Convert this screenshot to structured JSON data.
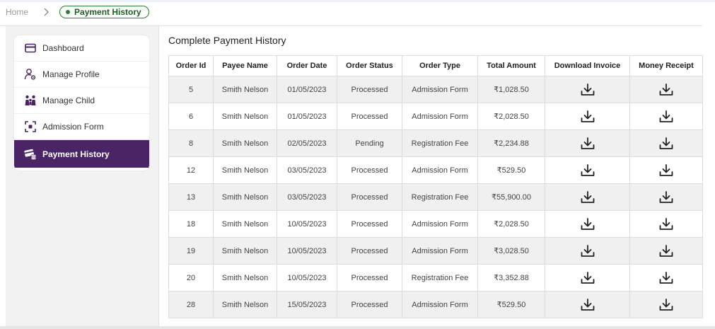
{
  "breadcrumb": {
    "home": "Home",
    "current": "Payment History"
  },
  "sidebar": {
    "items": [
      {
        "label": "Dashboard",
        "icon": "card-icon"
      },
      {
        "label": "Manage Profile",
        "icon": "profile-gear-icon"
      },
      {
        "label": "Manage Child",
        "icon": "family-icon"
      },
      {
        "label": "Admission Form",
        "icon": "scan-icon"
      },
      {
        "label": "Payment History",
        "icon": "payment-icon",
        "active": true
      }
    ]
  },
  "main": {
    "title": "Complete Payment History",
    "columns": [
      "Order Id",
      "Payee Name",
      "Order Date",
      "Order Status",
      "Order Type",
      "Total Amount",
      "Download Invoice",
      "Money Receipt"
    ],
    "rows": [
      {
        "id": "5",
        "payee": "Smith Nelson",
        "date": "01/05/2023",
        "status": "Processed",
        "type": "Admission Form",
        "amount": "₹1,028.50"
      },
      {
        "id": "6",
        "payee": "Smith Nelson",
        "date": "01/05/2023",
        "status": "Processed",
        "type": "Admission Form",
        "amount": "₹2,028.50"
      },
      {
        "id": "8",
        "payee": "Smith Nelson",
        "date": "02/05/2023",
        "status": "Pending",
        "type": "Registration Fee",
        "amount": "₹2,234.88"
      },
      {
        "id": "12",
        "payee": "Smith Nelson",
        "date": "03/05/2023",
        "status": "Processed",
        "type": "Admission Form",
        "amount": "₹529.50"
      },
      {
        "id": "13",
        "payee": "Smith Nelson",
        "date": "03/05/2023",
        "status": "Processed",
        "type": "Registration Fee",
        "amount": "₹55,900.00"
      },
      {
        "id": "18",
        "payee": "Smith Nelson",
        "date": "10/05/2023",
        "status": "Processed",
        "type": "Admission Form",
        "amount": "₹2,028.50"
      },
      {
        "id": "19",
        "payee": "Smith Nelson",
        "date": "10/05/2023",
        "status": "Processed",
        "type": "Admission Form",
        "amount": "₹3,028.50"
      },
      {
        "id": "20",
        "payee": "Smith Nelson",
        "date": "10/05/2023",
        "status": "Processed",
        "type": "Registration Fee",
        "amount": "₹3,352.88"
      },
      {
        "id": "28",
        "payee": "Smith Nelson",
        "date": "15/05/2023",
        "status": "Processed",
        "type": "Admission Form",
        "amount": "₹529.50"
      }
    ]
  },
  "colors": {
    "accent": "#4b2466",
    "breadcrumb_active": "#2e7d32",
    "payee_text": "#5a3d7a",
    "row_alt": "#f0f0f0"
  }
}
